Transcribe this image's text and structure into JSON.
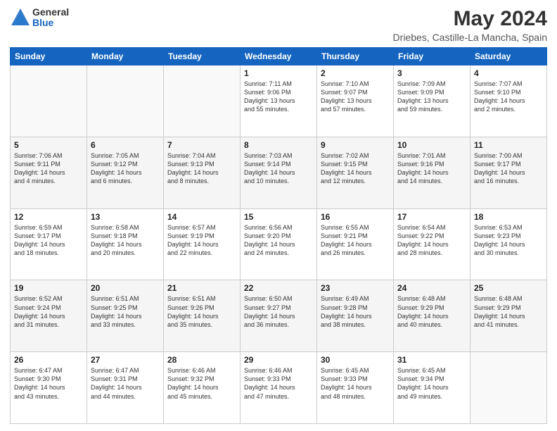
{
  "header": {
    "logo_general": "General",
    "logo_blue": "Blue",
    "month_title": "May 2024",
    "location": "Driebes, Castille-La Mancha, Spain"
  },
  "days_of_week": [
    "Sunday",
    "Monday",
    "Tuesday",
    "Wednesday",
    "Thursday",
    "Friday",
    "Saturday"
  ],
  "weeks": [
    {
      "days": [
        {
          "number": "",
          "info": ""
        },
        {
          "number": "",
          "info": ""
        },
        {
          "number": "",
          "info": ""
        },
        {
          "number": "1",
          "info": "Sunrise: 7:11 AM\nSunset: 9:06 PM\nDaylight: 13 hours\nand 55 minutes."
        },
        {
          "number": "2",
          "info": "Sunrise: 7:10 AM\nSunset: 9:07 PM\nDaylight: 13 hours\nand 57 minutes."
        },
        {
          "number": "3",
          "info": "Sunrise: 7:09 AM\nSunset: 9:09 PM\nDaylight: 13 hours\nand 59 minutes."
        },
        {
          "number": "4",
          "info": "Sunrise: 7:07 AM\nSunset: 9:10 PM\nDaylight: 14 hours\nand 2 minutes."
        }
      ]
    },
    {
      "days": [
        {
          "number": "5",
          "info": "Sunrise: 7:06 AM\nSunset: 9:11 PM\nDaylight: 14 hours\nand 4 minutes."
        },
        {
          "number": "6",
          "info": "Sunrise: 7:05 AM\nSunset: 9:12 PM\nDaylight: 14 hours\nand 6 minutes."
        },
        {
          "number": "7",
          "info": "Sunrise: 7:04 AM\nSunset: 9:13 PM\nDaylight: 14 hours\nand 8 minutes."
        },
        {
          "number": "8",
          "info": "Sunrise: 7:03 AM\nSunset: 9:14 PM\nDaylight: 14 hours\nand 10 minutes."
        },
        {
          "number": "9",
          "info": "Sunrise: 7:02 AM\nSunset: 9:15 PM\nDaylight: 14 hours\nand 12 minutes."
        },
        {
          "number": "10",
          "info": "Sunrise: 7:01 AM\nSunset: 9:16 PM\nDaylight: 14 hours\nand 14 minutes."
        },
        {
          "number": "11",
          "info": "Sunrise: 7:00 AM\nSunset: 9:17 PM\nDaylight: 14 hours\nand 16 minutes."
        }
      ]
    },
    {
      "days": [
        {
          "number": "12",
          "info": "Sunrise: 6:59 AM\nSunset: 9:17 PM\nDaylight: 14 hours\nand 18 minutes."
        },
        {
          "number": "13",
          "info": "Sunrise: 6:58 AM\nSunset: 9:18 PM\nDaylight: 14 hours\nand 20 minutes."
        },
        {
          "number": "14",
          "info": "Sunrise: 6:57 AM\nSunset: 9:19 PM\nDaylight: 14 hours\nand 22 minutes."
        },
        {
          "number": "15",
          "info": "Sunrise: 6:56 AM\nSunset: 9:20 PM\nDaylight: 14 hours\nand 24 minutes."
        },
        {
          "number": "16",
          "info": "Sunrise: 6:55 AM\nSunset: 9:21 PM\nDaylight: 14 hours\nand 26 minutes."
        },
        {
          "number": "17",
          "info": "Sunrise: 6:54 AM\nSunset: 9:22 PM\nDaylight: 14 hours\nand 28 minutes."
        },
        {
          "number": "18",
          "info": "Sunrise: 6:53 AM\nSunset: 9:23 PM\nDaylight: 14 hours\nand 30 minutes."
        }
      ]
    },
    {
      "days": [
        {
          "number": "19",
          "info": "Sunrise: 6:52 AM\nSunset: 9:24 PM\nDaylight: 14 hours\nand 31 minutes."
        },
        {
          "number": "20",
          "info": "Sunrise: 6:51 AM\nSunset: 9:25 PM\nDaylight: 14 hours\nand 33 minutes."
        },
        {
          "number": "21",
          "info": "Sunrise: 6:51 AM\nSunset: 9:26 PM\nDaylight: 14 hours\nand 35 minutes."
        },
        {
          "number": "22",
          "info": "Sunrise: 6:50 AM\nSunset: 9:27 PM\nDaylight: 14 hours\nand 36 minutes."
        },
        {
          "number": "23",
          "info": "Sunrise: 6:49 AM\nSunset: 9:28 PM\nDaylight: 14 hours\nand 38 minutes."
        },
        {
          "number": "24",
          "info": "Sunrise: 6:48 AM\nSunset: 9:29 PM\nDaylight: 14 hours\nand 40 minutes."
        },
        {
          "number": "25",
          "info": "Sunrise: 6:48 AM\nSunset: 9:29 PM\nDaylight: 14 hours\nand 41 minutes."
        }
      ]
    },
    {
      "days": [
        {
          "number": "26",
          "info": "Sunrise: 6:47 AM\nSunset: 9:30 PM\nDaylight: 14 hours\nand 43 minutes."
        },
        {
          "number": "27",
          "info": "Sunrise: 6:47 AM\nSunset: 9:31 PM\nDaylight: 14 hours\nand 44 minutes."
        },
        {
          "number": "28",
          "info": "Sunrise: 6:46 AM\nSunset: 9:32 PM\nDaylight: 14 hours\nand 45 minutes."
        },
        {
          "number": "29",
          "info": "Sunrise: 6:46 AM\nSunset: 9:33 PM\nDaylight: 14 hours\nand 47 minutes."
        },
        {
          "number": "30",
          "info": "Sunrise: 6:45 AM\nSunset: 9:33 PM\nDaylight: 14 hours\nand 48 minutes."
        },
        {
          "number": "31",
          "info": "Sunrise: 6:45 AM\nSunset: 9:34 PM\nDaylight: 14 hours\nand 49 minutes."
        },
        {
          "number": "",
          "info": ""
        }
      ]
    }
  ]
}
